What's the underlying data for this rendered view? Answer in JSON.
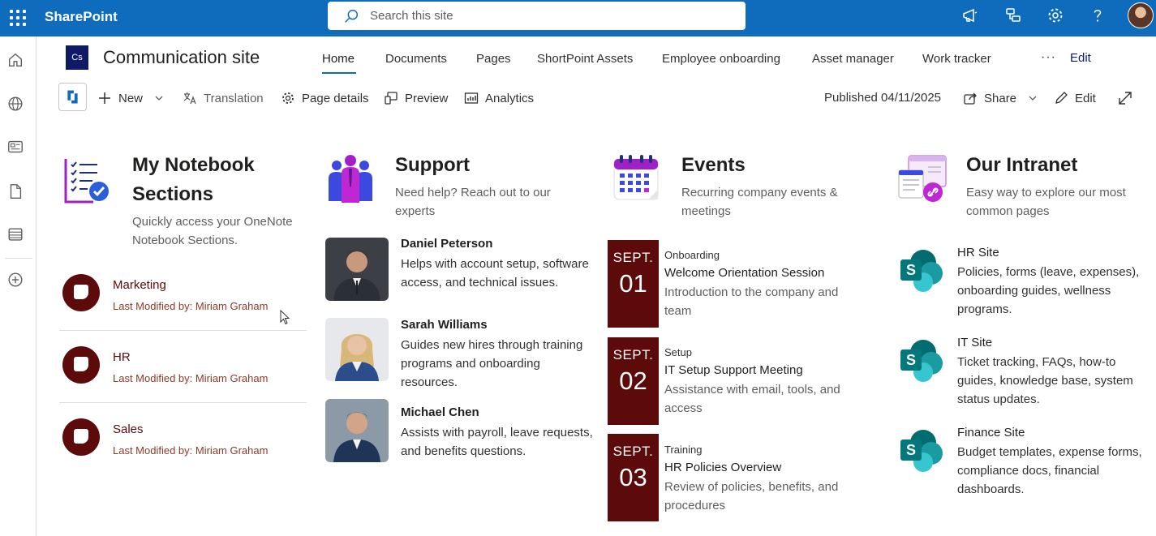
{
  "suite": {
    "brand": "SharePoint",
    "search_placeholder": "Search this site"
  },
  "site": {
    "logo_text": "Cs",
    "title": "Communication site",
    "nav": [
      "Home",
      "Documents",
      "Pages",
      "ShortPoint Assets",
      "Employee onboarding",
      "Asset manager",
      "Work tracker"
    ],
    "nav_more": "···",
    "nav_edit": "Edit"
  },
  "commandbar": {
    "new": "New",
    "translation": "Translation",
    "page_details": "Page details",
    "preview": "Preview",
    "analytics": "Analytics",
    "published": "Published 04/11/2025",
    "share": "Share",
    "edit": "Edit"
  },
  "notebook": {
    "title": "My Notebook Sections",
    "title_line1": "My Notebook",
    "title_line2": "Sections",
    "desc_line1": "Quickly access your OneNote",
    "desc_line2": "Notebook Sections.",
    "items": [
      {
        "name": "Marketing",
        "modified": "Last Modified by: Miriam Graham"
      },
      {
        "name": "HR",
        "modified": "Last Modified by: Miriam Graham"
      },
      {
        "name": "Sales",
        "modified": "Last Modified by: Miriam Graham"
      }
    ]
  },
  "support": {
    "title": "Support",
    "desc_line1": "Need help? Reach out to our",
    "desc_line2": "experts",
    "people": [
      {
        "name": "Daniel Peterson",
        "desc": "Helps with account setup, software access, and technical issues."
      },
      {
        "name": "Sarah Williams",
        "desc": "Guides new hires through training programs and onboarding resources."
      },
      {
        "name": "Michael Chen",
        "desc": "Assists with payroll, leave requests, and benefits questions."
      }
    ]
  },
  "events": {
    "title": "Events",
    "desc_line1": "Recurring company events &",
    "desc_line2": "meetings",
    "items": [
      {
        "month": "SEPT.",
        "day": "01",
        "category": "Onboarding",
        "title": "Welcome Orientation Session",
        "desc": "Introduction to the company and team"
      },
      {
        "month": "SEPT.",
        "day": "02",
        "category": "Setup",
        "title": "IT Setup Support Meeting",
        "desc": "Assistance with email, tools, and access"
      },
      {
        "month": "SEPT.",
        "day": "03",
        "category": "Training",
        "title": "HR Policies Overview",
        "desc": "Review of policies, benefits, and procedures"
      }
    ]
  },
  "intranet": {
    "title": "Our Intranet",
    "desc_line1": "Easy way to explore our most",
    "desc_line2": "common pages",
    "sites": [
      {
        "name": "HR Site",
        "desc": "Policies, forms (leave, expenses), onboarding guides, wellness programs."
      },
      {
        "name": "IT Site",
        "desc": "Ticket tracking, FAQs, how-to guides, knowledge base, system status updates."
      },
      {
        "name": "Finance Site",
        "desc": "Budget templates, expense forms, compliance docs, financial dashboards."
      }
    ]
  },
  "colors": {
    "suite_blue": "#0f6cbd",
    "maroon": "#5c0a0a",
    "sharepoint_teal": "#038387"
  },
  "icons": [
    "waffle-icon",
    "search-icon",
    "megaphone-icon",
    "feedback-icon",
    "settings-icon",
    "help-icon",
    "home-icon",
    "globe-icon",
    "news-icon",
    "document-icon",
    "list-icon",
    "add-icon"
  ]
}
